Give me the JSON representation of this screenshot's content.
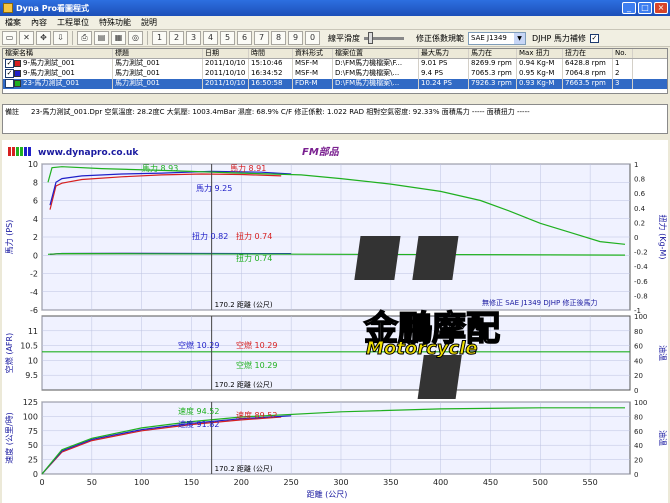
{
  "window": {
    "title": "Dyna Pro看圖程式",
    "min": "_",
    "max": "□",
    "close": "×"
  },
  "menu": [
    "檔案",
    "內容",
    "工程單位",
    "特殊功能",
    "說明"
  ],
  "toolbar": {
    "smoothing_label": "線平滑度",
    "standard_label": "修正係數規範",
    "standard_value": "SAE J1349",
    "djhp_label": "DJHP 馬力補修",
    "djhp_checked": true
  },
  "table": {
    "headers": [
      "檔案名稱",
      "標題",
      "日期",
      "時間",
      "資料形式",
      "檔案位置",
      "最大馬力",
      "馬力在",
      "Max 扭力",
      "扭力在",
      "No."
    ],
    "rows": [
      {
        "name": "9-馬力測試_001",
        "color": "#d62020",
        "title": "馬力測試_001",
        "date": "2011/10/10",
        "time": "15:10:46",
        "type": "MSF-M",
        "path": "D:\\FM馬力機檔案\\F...",
        "max_hp": "9.01 PS",
        "hp_at": "8269.9 rpm",
        "max_tq": "0.94 Kg-M",
        "tq_at": "6428.8 rpm",
        "no": "1"
      },
      {
        "name": "9-馬力測試_001",
        "color": "#2020c8",
        "title": "馬力測試_001",
        "date": "2011/10/10",
        "time": "16:34:52",
        "type": "MSF-M",
        "path": "D:\\FM馬力機檔案\\...",
        "max_hp": "9.4 PS",
        "hp_at": "7065.3 rpm",
        "max_tq": "0.95 Kg-M",
        "tq_at": "7064.8 rpm",
        "no": "2"
      },
      {
        "name": "23-馬力測試_001",
        "color": "#20b020",
        "title": "馬力測試_001",
        "date": "2011/10/10",
        "time": "16:50:58",
        "type": "FDR-M",
        "path": "D:\\FM馬力機檔案\\...",
        "max_hp": "10.24 PS",
        "hp_at": "7926.3 rpm",
        "max_tq": "0.93 Kg-M",
        "tq_at": "7663.5 rpm",
        "no": "3"
      }
    ]
  },
  "notes": {
    "label": "備註",
    "text": "23-馬力測試_001.Dpr  空氣溫度: 28.2度C   大氣壓: 1003.4mBar   濕度: 68.9%   C/F 修正係數: 1.022   RAD 相對空氣密度: 92.33%  面積馬力 -----  面積扭力 -----"
  },
  "chart_header": {
    "url": "www.dynapro.co.uk",
    "title": "FM部品"
  },
  "watermark": {
    "line1": "金鵬摩配",
    "line2": "Motorcycle"
  },
  "chart_data": [
    {
      "type": "line",
      "title": "",
      "ylabel": "馬力 (PS)",
      "y2label": "扭力 (Kg-M)",
      "ylim": [
        -6,
        10
      ],
      "y2lim": [
        -1,
        1
      ],
      "yticks": [
        -6,
        -4,
        -2,
        0,
        2,
        4,
        6,
        8,
        10
      ],
      "y2ticks": [
        -1,
        -0.8,
        -0.6,
        -0.4,
        -0.2,
        0,
        0.2,
        0.4,
        0.6,
        0.8,
        1
      ],
      "xlim": [
        0,
        590
      ],
      "grid": true,
      "cursor_x": 170.2,
      "cursor_label": "170.2 距離 (公尺)",
      "annotations": [
        {
          "text": "馬力 8.93",
          "color": "#20b020"
        },
        {
          "text": "馬力 8.91",
          "color": "#d62020"
        },
        {
          "text": "馬力 9.25",
          "color": "#2020c8"
        },
        {
          "text": "扭力 0.82",
          "color": "#2020c8"
        },
        {
          "text": "扭力 0.74",
          "color": "#d62020"
        },
        {
          "text": "扭力 0.74",
          "color": "#20b020"
        }
      ],
      "footer": "無修正 SAE J1349    DJHP 修正後馬力",
      "series": [
        {
          "name": "馬力測試_001 (1) 馬力",
          "color": "#d62020",
          "x": [
            8,
            14,
            20,
            40,
            80,
            120,
            160,
            200,
            240
          ],
          "y": [
            5.0,
            7.6,
            7.9,
            8.3,
            8.6,
            8.8,
            8.9,
            8.85,
            8.7
          ]
        },
        {
          "name": "馬力測試_001 (2) 馬力",
          "color": "#2020c8",
          "x": [
            8,
            14,
            20,
            40,
            80,
            120,
            170,
            220,
            250
          ],
          "y": [
            5.5,
            8.0,
            8.4,
            8.7,
            8.9,
            9.0,
            9.2,
            9.1,
            8.9
          ]
        },
        {
          "name": "馬力測試_001 (3) 馬力",
          "color": "#20b020",
          "x": [
            6,
            10,
            20,
            60,
            120,
            200,
            260,
            300,
            350,
            400,
            440,
            470,
            500,
            530,
            560,
            585
          ],
          "y": [
            8.0,
            9.6,
            9.7,
            9.5,
            9.3,
            9.0,
            8.8,
            8.4,
            7.8,
            7.0,
            6.0,
            4.8,
            3.5,
            2.5,
            1.5,
            1.2
          ]
        },
        {
          "name": "馬力測試_001 (1) 扭力",
          "color": "#d62020",
          "x": [
            8,
            20,
            80,
            160,
            240
          ],
          "y": [
            0.1,
            0.18,
            0.19,
            0.18,
            0.17
          ]
        },
        {
          "name": "馬力測試_001 (2) 扭力",
          "color": "#2020c8",
          "x": [
            8,
            20,
            80,
            170,
            250
          ],
          "y": [
            0.1,
            0.19,
            0.2,
            0.19,
            0.18
          ]
        },
        {
          "name": "馬力測試_001 (3) 扭力",
          "color": "#20b020",
          "x": [
            6,
            20,
            100,
            300,
            585
          ],
          "y": [
            0.1,
            0.18,
            0.16,
            0.1,
            0.02
          ]
        }
      ]
    },
    {
      "type": "line",
      "ylabel": "空燃 (AFR)",
      "y2label": "油溫",
      "ylim": [
        9,
        11.5
      ],
      "yticks": [
        9.5,
        10.0,
        10.5,
        11.0
      ],
      "y2lim": [
        0,
        100
      ],
      "y2ticks": [
        0,
        20,
        40,
        60,
        80,
        100
      ],
      "xlim": [
        0,
        590
      ],
      "grid": true,
      "cursor_label": "170.2 距離 (公尺)",
      "annotations": [
        {
          "text": "空燃 10.29",
          "color": "#2020c8"
        },
        {
          "text": "空燃 10.29",
          "color": "#d62020"
        },
        {
          "text": "空燃 10.29",
          "color": "#20b020"
        }
      ],
      "series": [
        {
          "name": "馬力測試_001 (3) 空燃",
          "color": "#20b020",
          "x": [
            0,
            590
          ],
          "y": [
            10.29,
            10.29
          ]
        }
      ]
    },
    {
      "type": "line",
      "ylabel": "速度 (公里/時)",
      "y2label": "油溫",
      "ylim": [
        0,
        125
      ],
      "yticks": [
        0,
        25,
        50,
        75,
        100,
        125
      ],
      "y2lim": [
        0,
        100
      ],
      "y2ticks": [
        0,
        20,
        40,
        60,
        80,
        100
      ],
      "xlim": [
        0,
        590
      ],
      "xticks": [
        0,
        50,
        100,
        150,
        200,
        250,
        300,
        350,
        400,
        450,
        500,
        550
      ],
      "xlabel": "距離 (公尺)",
      "grid": true,
      "cursor_label": "170.2 距離 (公尺)",
      "annotations": [
        {
          "text": "速度 94.52",
          "color": "#20b020"
        },
        {
          "text": "速度 91.82",
          "color": "#2020c8"
        },
        {
          "text": "速度 89.52",
          "color": "#d62020"
        }
      ],
      "series": [
        {
          "name": "馬力測試_001 (1) 速度",
          "color": "#d62020",
          "x": [
            0,
            20,
            50,
            100,
            150,
            200,
            240
          ],
          "y": [
            0,
            38,
            58,
            75,
            86,
            94,
            99
          ]
        },
        {
          "name": "馬力測試_001 (2) 速度",
          "color": "#2020c8",
          "x": [
            0,
            20,
            50,
            100,
            150,
            200,
            250
          ],
          "y": [
            0,
            40,
            60,
            77,
            88,
            96,
            101
          ]
        },
        {
          "name": "馬力測試_001 (3) 速度",
          "color": "#20b020",
          "x": [
            0,
            20,
            50,
            100,
            150,
            200,
            300,
            400,
            500,
            585
          ],
          "y": [
            0,
            42,
            62,
            80,
            91,
            99,
            108,
            113,
            115,
            115
          ]
        }
      ]
    }
  ]
}
